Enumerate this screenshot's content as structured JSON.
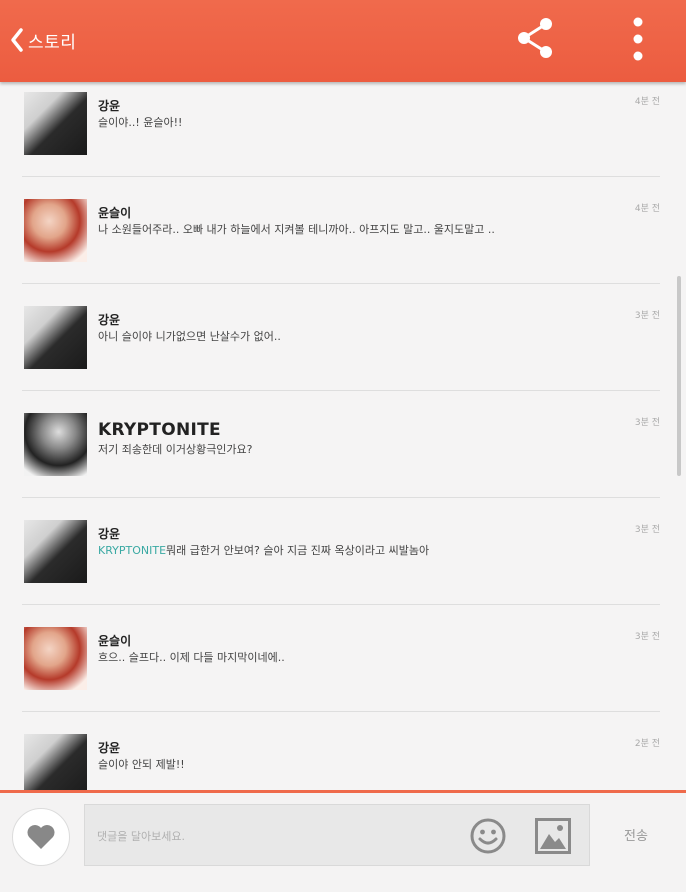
{
  "header": {
    "back_label": "스토리",
    "color": "#ee6245"
  },
  "comments": [
    {
      "name": "강윤",
      "message": "슬이야..! 윤슬아!!",
      "time": "4분 전",
      "avatar": "couple"
    },
    {
      "name": "윤슬이",
      "message": "나 소원들어주라.. 오빠 내가 하늘에서 지켜볼 테니까아.. 아프지도 말고.. 울지도말고 ..",
      "time": "4분 전",
      "avatar": "girl"
    },
    {
      "name": "강윤",
      "message": "아니 슬이야 니가없으면 난살수가 없어..",
      "time": "3분 전",
      "avatar": "couple"
    },
    {
      "name": "KRYPTONITE",
      "message": "저기 죄송한데 이거상황극인가요?",
      "time": "3분 전",
      "avatar": "guy"
    },
    {
      "name": "강윤",
      "mention": "KRYPTONITE",
      "message": "뭐래 급한거 안보여? 슬아 지금 진짜 옥상이라고 씨발놈아",
      "time": "3분 전",
      "avatar": "couple"
    },
    {
      "name": "윤슬이",
      "message": "흐으.. 슬프다.. 이제 다들 마지막이네에..",
      "time": "3분 전",
      "avatar": "girl"
    },
    {
      "name": "강윤",
      "message": "슬이야 안되 제발!!",
      "time": "2분 전",
      "avatar": "couple"
    }
  ],
  "composer": {
    "placeholder": "댓글을 달아보세요.",
    "send_label": "전송"
  },
  "icons": {
    "back": "chevron-left-icon",
    "share": "share-icon",
    "more": "more-vertical-icon",
    "like": "heart-icon",
    "emoji": "smiley-icon",
    "image": "image-icon"
  }
}
